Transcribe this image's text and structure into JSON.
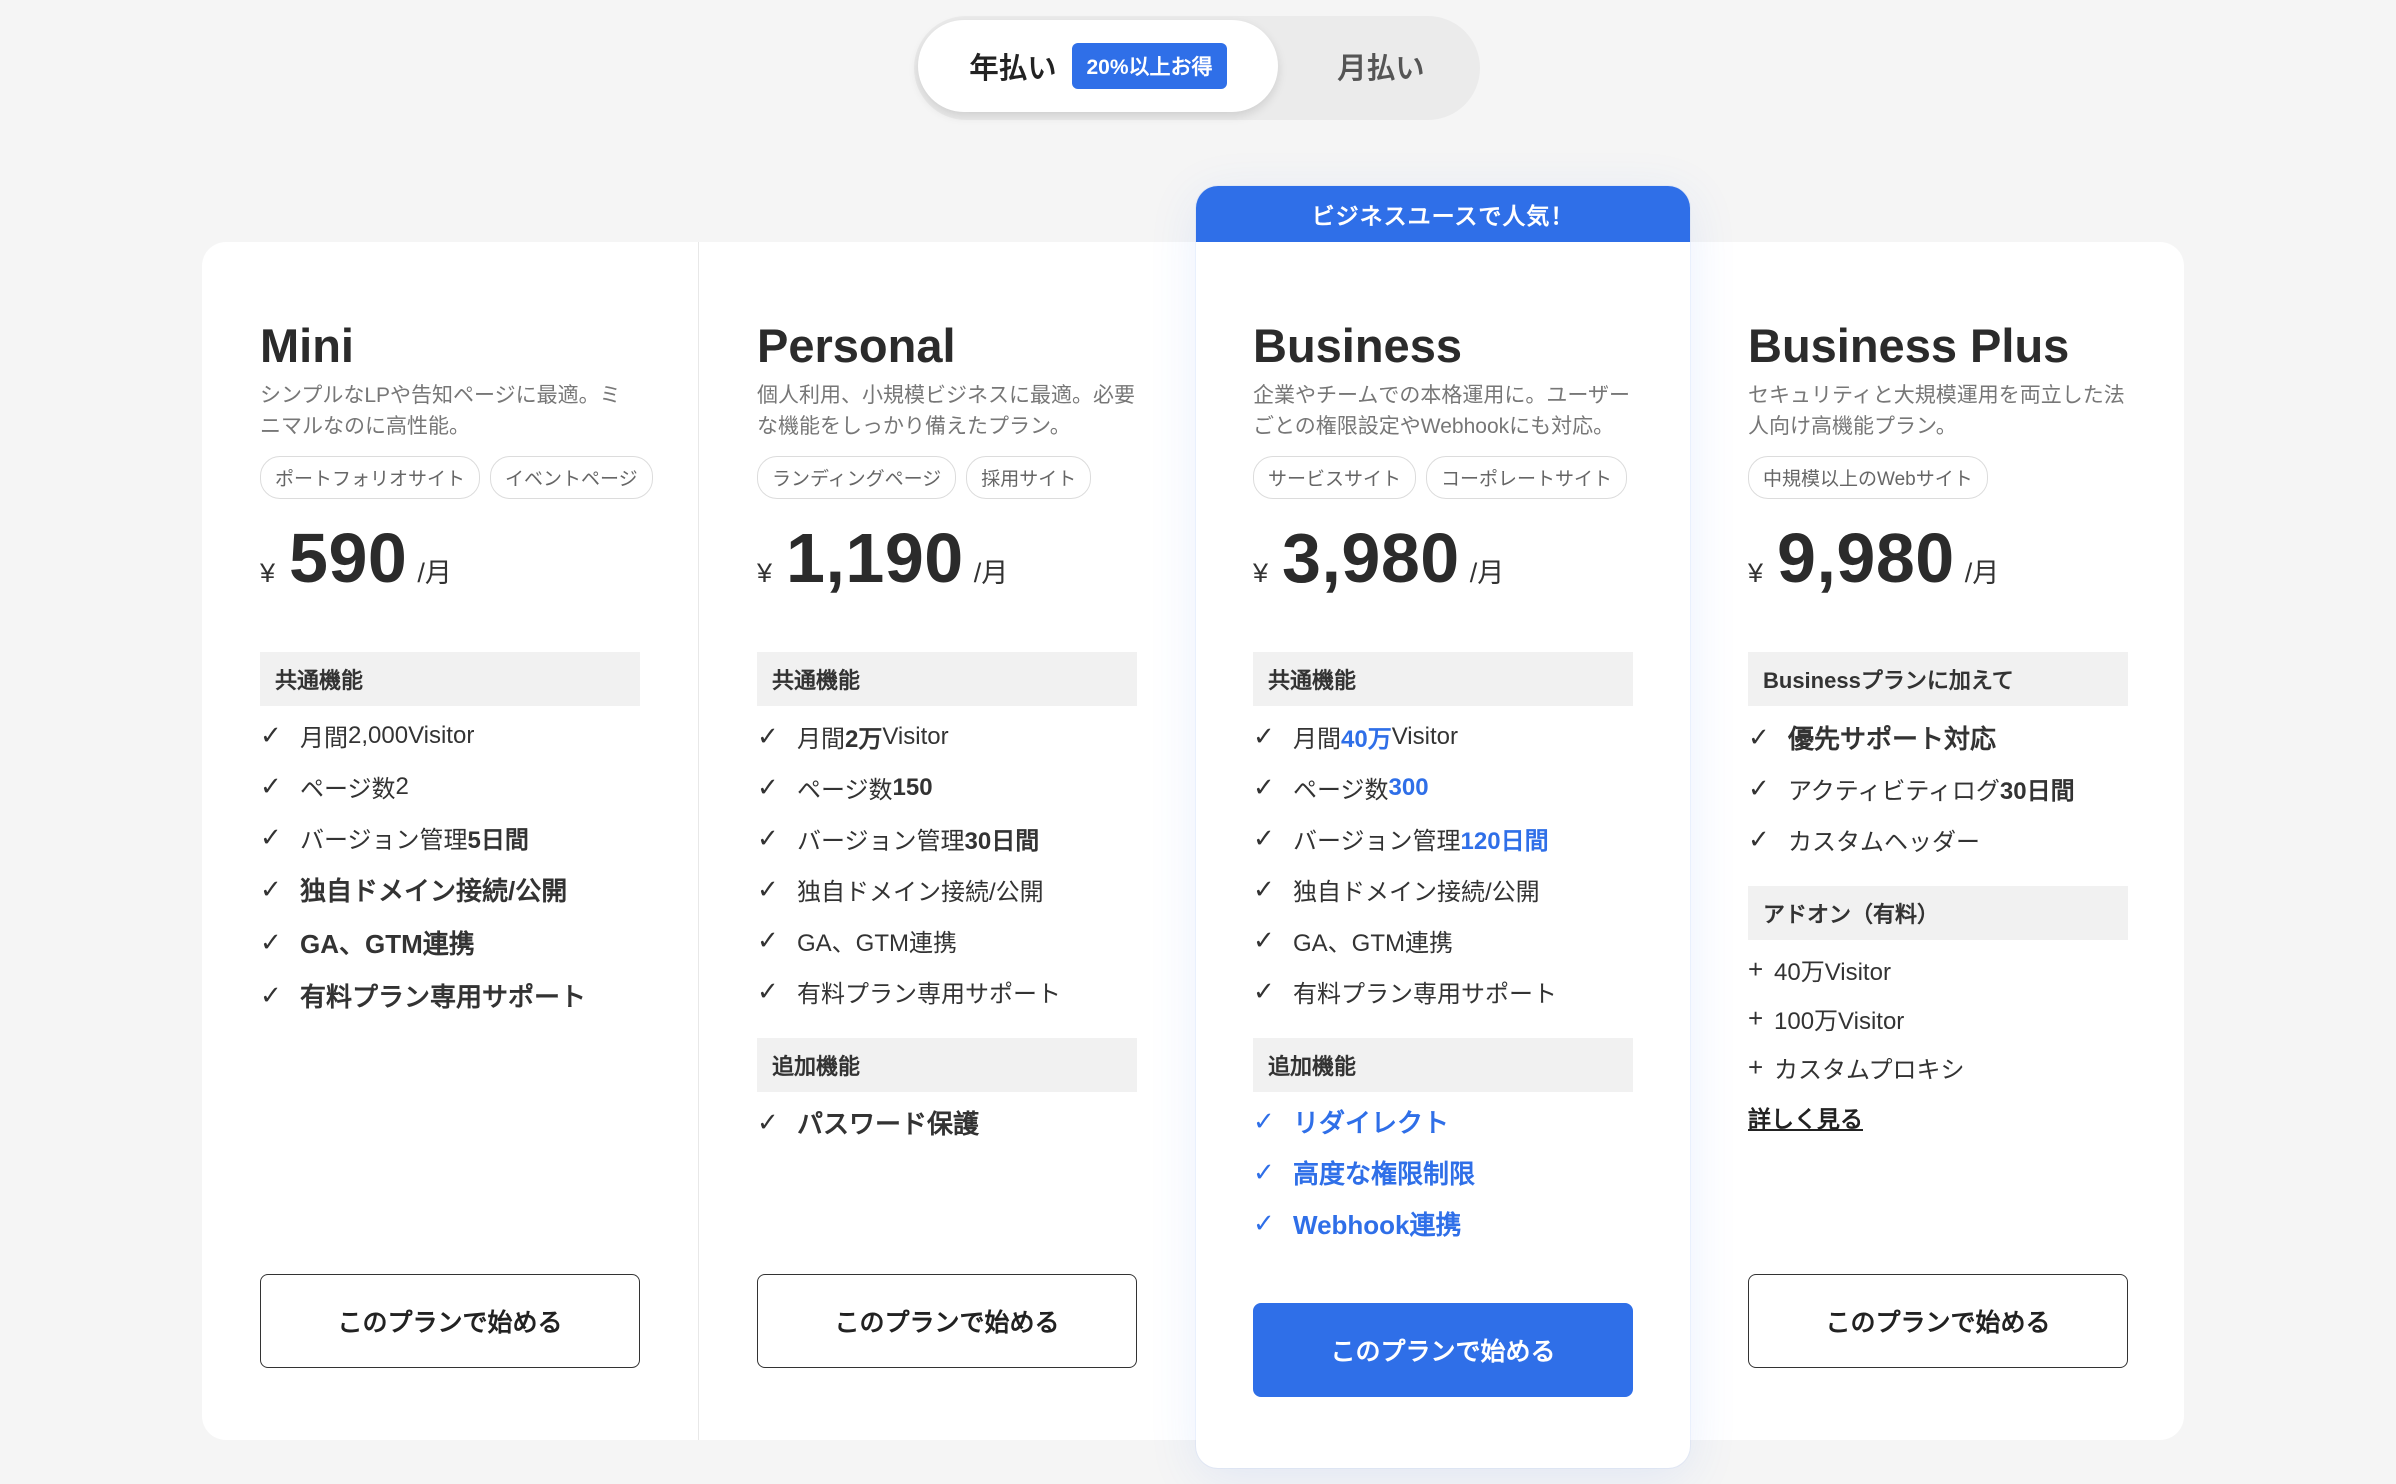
{
  "billing_toggle": {
    "annual_label": "年払い",
    "discount_badge": "20%以上お得",
    "monthly_label": "月払い",
    "selected": "annual"
  },
  "featured_ribbon": "ビジネスユースで人気！",
  "colors": {
    "accent": "#2f6fe8",
    "page_bg": "#f5f5f5",
    "section_bg": "#f1f1f1"
  },
  "plans": [
    {
      "name": "Mini",
      "description": "シンプルなLPや告知ページに最適。ミニマルなのに高性能。",
      "tags": [
        "ポートフォリオサイト",
        "イベントページ"
      ],
      "price": {
        "currency": "¥",
        "amount": "590",
        "unit": "/月"
      },
      "sections": [
        {
          "heading": "共通機能",
          "features": [
            {
              "prefix": "月間 ",
              "value": "2,000",
              "suffix": " Visitor",
              "style": "normal"
            },
            {
              "prefix": "ページ数 ",
              "value": "2",
              "suffix": "",
              "style": "normal"
            },
            {
              "prefix": "バージョン管理 ",
              "value": "5日間",
              "suffix": "",
              "style": "normal",
              "value_bold": true
            },
            {
              "prefix": "独自ドメイン接続/公開",
              "value": "",
              "suffix": "",
              "style": "bold"
            },
            {
              "prefix": "GA、GTM連携",
              "value": "",
              "suffix": "",
              "style": "bold"
            },
            {
              "prefix": "有料プラン専用サポート",
              "value": "",
              "suffix": "",
              "style": "bold"
            }
          ]
        }
      ],
      "cta_label": "このプランで始める"
    },
    {
      "name": "Personal",
      "description": "個人利用、小規模ビジネスに最適。必要な機能をしっかり備えたプラン。",
      "tags": [
        "ランディングページ",
        "採用サイト"
      ],
      "price": {
        "currency": "¥",
        "amount": "1,190",
        "unit": "/月"
      },
      "sections": [
        {
          "heading": "共通機能",
          "features": [
            {
              "prefix": "月間 ",
              "value": "2万",
              "suffix": " Visitor"
            },
            {
              "prefix": "ページ数 ",
              "value": "150",
              "suffix": ""
            },
            {
              "prefix": "バージョン管理 ",
              "value": "30日間",
              "suffix": ""
            },
            {
              "prefix": "独自ドメイン接続/公開",
              "value": "",
              "suffix": ""
            },
            {
              "prefix": "GA、GTM連携",
              "value": "",
              "suffix": ""
            },
            {
              "prefix": "有料プラン専用サポート",
              "value": "",
              "suffix": ""
            }
          ]
        },
        {
          "heading": "追加機能",
          "features": [
            {
              "prefix": "パスワード保護",
              "value": "",
              "suffix": ""
            }
          ]
        }
      ],
      "cta_label": "このプランで始める"
    },
    {
      "name": "Business",
      "description": "企業やチームでの本格運用に。ユーザーごとの権限設定やWebhookにも対応。",
      "tags": [
        "サービスサイト",
        "コーポレートサイト"
      ],
      "price": {
        "currency": "¥",
        "amount": "3,980",
        "unit": "/月"
      },
      "sections": [
        {
          "heading": "共通機能",
          "features": [
            {
              "prefix": "月間 ",
              "value": "40万",
              "suffix": " Visitor"
            },
            {
              "prefix": "ページ数 ",
              "value": "300",
              "suffix": ""
            },
            {
              "prefix": "バージョン管理 ",
              "value": "120日間",
              "suffix": ""
            },
            {
              "prefix": "独自ドメイン接続/公開",
              "value": "",
              "suffix": ""
            },
            {
              "prefix": "GA、GTM連携",
              "value": "",
              "suffix": ""
            },
            {
              "prefix": "有料プラン専用サポート",
              "value": "",
              "suffix": ""
            }
          ]
        },
        {
          "heading": "追加機能",
          "features": [
            {
              "prefix": "リダイレクト",
              "value": "",
              "suffix": ""
            },
            {
              "prefix": "高度な権限制限",
              "value": "",
              "suffix": ""
            },
            {
              "prefix": "Webhook連携",
              "value": "",
              "suffix": ""
            }
          ]
        }
      ],
      "cta_label": "このプランで始める"
    },
    {
      "name": "Business Plus",
      "description": "セキュリティと大規模運用を両立した法人向け高機能プラン。",
      "tags": [
        "中規模以上のWebサイト"
      ],
      "price": {
        "currency": "¥",
        "amount": "9,980",
        "unit": "/月"
      },
      "sections": [
        {
          "heading": "Businessプランに加えて",
          "features": [
            {
              "prefix": "優先サポート対応",
              "value": "",
              "suffix": ""
            },
            {
              "prefix": "アクティビティログ",
              "value": "30日間",
              "suffix": ""
            },
            {
              "prefix": "カスタムヘッダー",
              "value": "",
              "suffix": ""
            }
          ]
        },
        {
          "heading": "アドオン（有料）",
          "features": [
            {
              "prefix": "+",
              "value": "",
              "suffix": "40万Visitor"
            },
            {
              "prefix": "+",
              "value": "",
              "suffix": "100万Visitor"
            },
            {
              "prefix": "+",
              "value": "",
              "suffix": "カスタムプロキシ"
            }
          ]
        }
      ],
      "more_link": "詳しく見る",
      "cta_label": "このプランで始める"
    }
  ]
}
